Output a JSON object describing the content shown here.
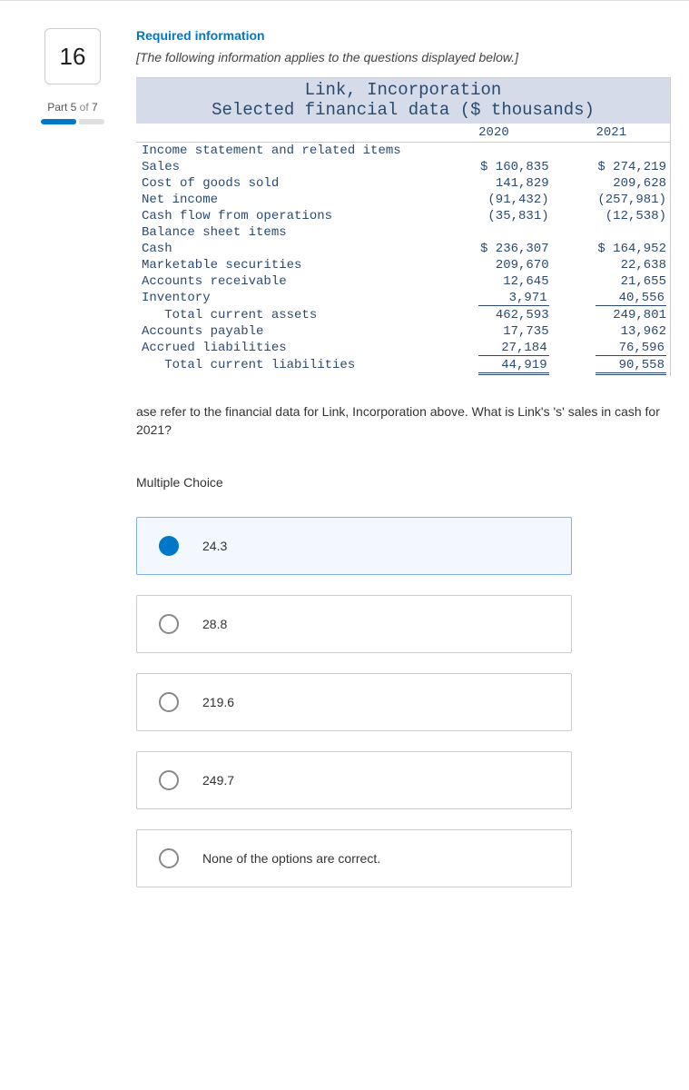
{
  "question_number": "16",
  "part_label_prefix": "Part",
  "part_current": "5",
  "part_of": "of",
  "part_total": "7",
  "required_info": "Required information",
  "bracket_note": "[The following information applies to the questions displayed below.]",
  "fin_header_line1": "Link, Incorporation",
  "fin_header_line2": "Selected financial data ($ thousands)",
  "col_2020": "2020",
  "col_2021": "2021",
  "rows": [
    {
      "label": "Income statement and related items",
      "v2020": "",
      "v2021": ""
    },
    {
      "label": "Sales",
      "v2020": "$ 160,835",
      "v2021": "$ 274,219"
    },
    {
      "label": "Cost of goods sold",
      "v2020": "141,829",
      "v2021": "209,628"
    },
    {
      "label": "Net income",
      "v2020": "(91,432)",
      "v2021": "(257,981)"
    },
    {
      "label": "Cash flow from operations",
      "v2020": "(35,831)",
      "v2021": "(12,538)"
    },
    {
      "label": "Balance sheet items",
      "v2020": "",
      "v2021": ""
    },
    {
      "label": "Cash",
      "v2020": "$ 236,307",
      "v2021": "$ 164,952"
    },
    {
      "label": "Marketable securities",
      "v2020": "209,670",
      "v2021": "22,638"
    },
    {
      "label": "Accounts receivable",
      "v2020": "12,645",
      "v2021": "21,655"
    },
    {
      "label": "Inventory",
      "v2020": "3,971",
      "v2021": "40,556"
    },
    {
      "label": "   Total current assets",
      "v2020": "462,593",
      "v2021": "249,801"
    },
    {
      "label": "Accounts payable",
      "v2020": "17,735",
      "v2021": "13,962"
    },
    {
      "label": "Accrued liabilities",
      "v2020": "27,184",
      "v2021": "76,596"
    },
    {
      "label": "   Total current liabilities",
      "v2020": "44,919",
      "v2021": "90,558"
    }
  ],
  "question_text": "ase refer to the financial data for Link, Incorporation above. What is Link's 's' sales in cash for 2021?",
  "mc_label": "Multiple Choice",
  "choices": [
    {
      "label": "24.3",
      "selected": true
    },
    {
      "label": "28.8",
      "selected": false
    },
    {
      "label": "219.6",
      "selected": false
    },
    {
      "label": "249.7",
      "selected": false
    },
    {
      "label": "None of the options are correct.",
      "selected": false
    }
  ]
}
